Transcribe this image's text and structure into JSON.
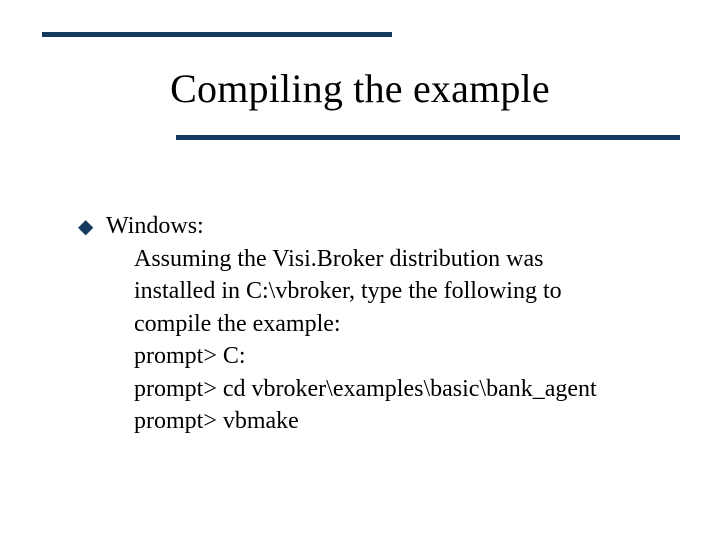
{
  "colors": {
    "rule": "#163a5f",
    "bullet": "#163a5f",
    "text": "#000000",
    "background": "#ffffff"
  },
  "title": "Compiling the example",
  "bullet": {
    "marker": "◆",
    "head": "Windows:",
    "lines": [
      "Assuming the Visi.Broker distribution was",
      "installed in C:\\vbroker, type the following to",
      "compile the example:",
      "prompt> C:",
      "prompt> cd vbroker\\examples\\basic\\bank_agent",
      "prompt> vbmake"
    ]
  }
}
